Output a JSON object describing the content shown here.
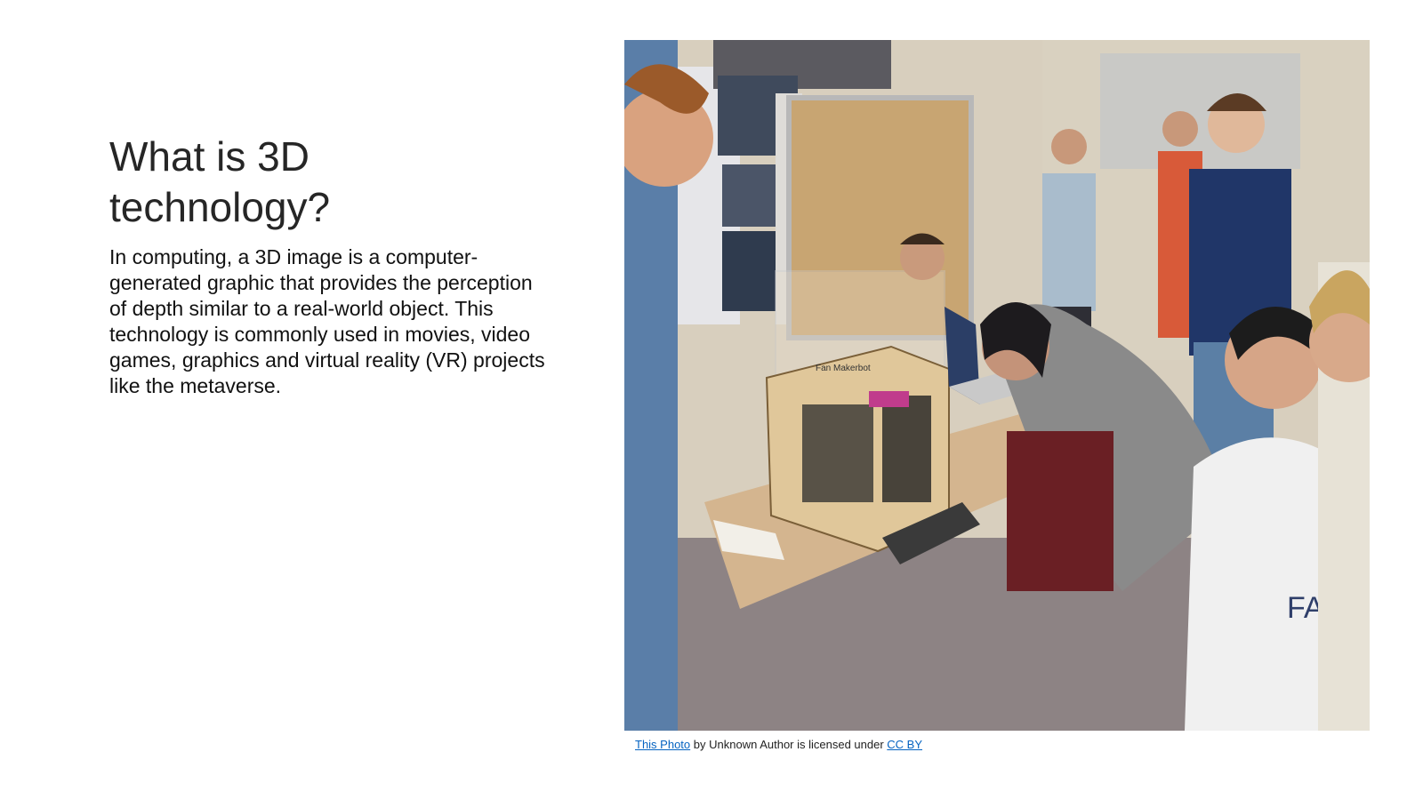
{
  "slide": {
    "title_line1": "What is 3D",
    "title_line2": "technology?",
    "body": "In computing, a 3D image is a computer-generated graphic that provides the perception of depth similar to a real-world object. This technology is commonly used in movies, video games, graphics and virtual reality (VR) projects like the metaverse."
  },
  "photo": {
    "printer_sign_text": "Fan Makerbot",
    "shirt_text": "FAI"
  },
  "caption": {
    "link1": "This Photo",
    "middle": " by Unknown Author is licensed under ",
    "link2": "CC BY"
  }
}
